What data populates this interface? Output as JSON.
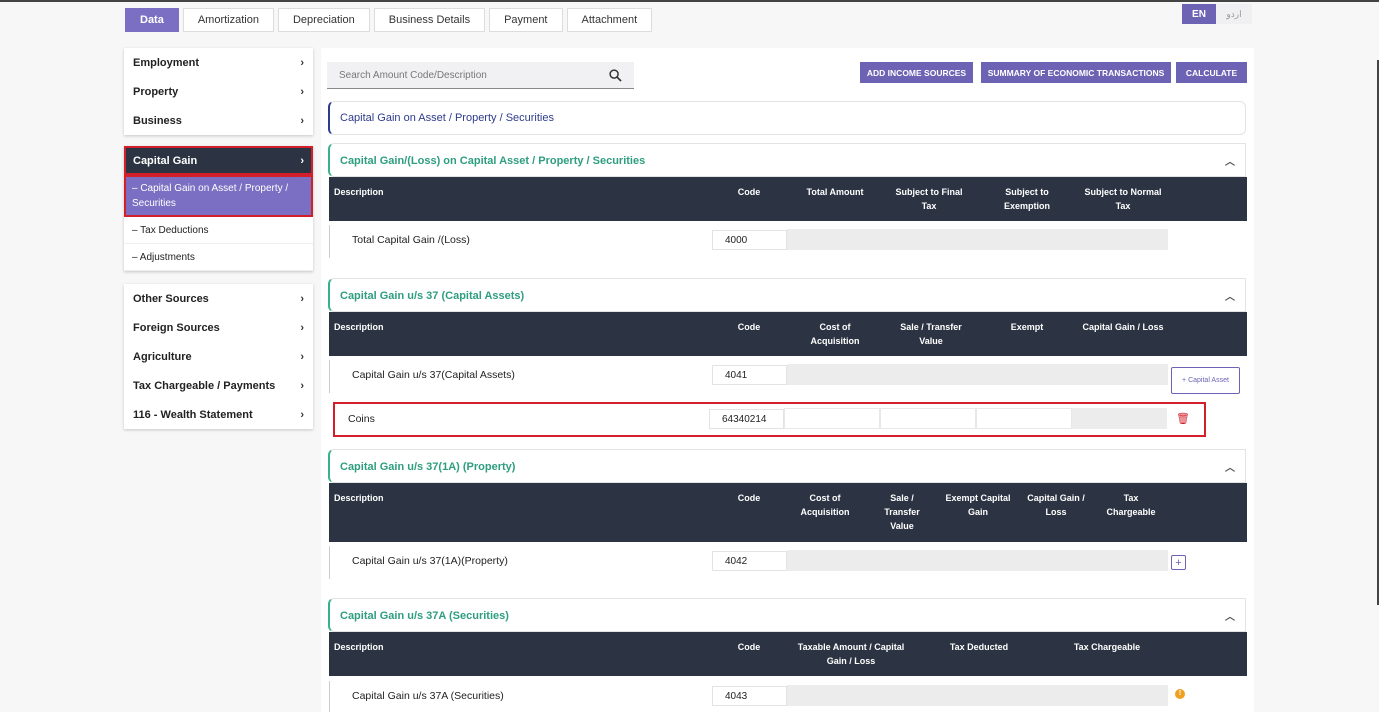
{
  "tabs": [
    "Data",
    "Amortization",
    "Depreciation",
    "Business Details",
    "Payment",
    "Attachment"
  ],
  "lang": {
    "en": "EN",
    "ur": "اردو"
  },
  "sidebar": {
    "group1": [
      "Employment",
      "Property",
      "Business"
    ],
    "capital_gain": "Capital Gain",
    "subs": [
      "– Capital Gain on Asset / Property / Securities",
      "– Tax Deductions",
      "– Adjustments"
    ],
    "group3": [
      "Other Sources",
      "Foreign Sources",
      "Agriculture",
      "Tax Chargeable / Payments",
      "116 - Wealth Statement"
    ]
  },
  "search": {
    "placeholder": "Search Amount Code/Description"
  },
  "buttons": {
    "add_income": "ADD INCOME SOURCES",
    "summary": "SUMMARY OF ECONOMIC TRANSACTIONS",
    "calculate": "CALCULATE"
  },
  "section_title": "Capital Gain on Asset / Property / Securities",
  "sections": {
    "s1": {
      "title": "Capital Gain/(Loss) on Capital Asset / Property / Securities",
      "headers": [
        "Description",
        "Code",
        "Total Amount",
        "Subject to Final Tax",
        "Subject to Exemption",
        "Subject to Normal Tax"
      ],
      "row": {
        "desc": "Total Capital Gain /(Loss)",
        "code": "4000"
      }
    },
    "s2": {
      "title": "Capital Gain u/s 37 (Capital Assets)",
      "headers": [
        "Description",
        "Code",
        "Cost of Acquisition",
        "Sale / Transfer Value",
        "Exempt",
        "Capital Gain / Loss"
      ],
      "row": {
        "desc": "Capital Gain u/s 37(Capital Assets)",
        "code": "4041"
      },
      "add_label": "+ Capital Asset",
      "row2": {
        "desc": "Coins",
        "code": "64340214"
      }
    },
    "s3": {
      "title": "Capital Gain u/s 37(1A) (Property)",
      "headers": [
        "Description",
        "Code",
        "Cost of Acquisition",
        "Sale / Transfer Value",
        "Exempt Capital Gain",
        "Capital Gain / Loss",
        "Tax Chargeable"
      ],
      "row": {
        "desc": "Capital Gain u/s 37(1A)(Property)",
        "code": "4042"
      }
    },
    "s4": {
      "title": "Capital Gain u/s 37A (Securities)",
      "headers": [
        "Description",
        "Code",
        "Taxable Amount / Capital Gain / Loss",
        "Tax Deducted",
        "Tax Chargeable"
      ],
      "row": {
        "desc": "Capital Gain u/s 37A (Securities)",
        "code": "4043"
      }
    }
  },
  "colors": {
    "accent": "#7a6fc2",
    "header_dark": "#2c3342",
    "section_green": "#2e9e7e",
    "highlight_red": "#d21f2a"
  },
  "icons": {
    "search": "search-icon",
    "chevron": "chevron-right-icon",
    "collapse": "chevron-up-icon",
    "trash": "trash-icon",
    "info": "info-icon",
    "plus": "plus-icon"
  }
}
